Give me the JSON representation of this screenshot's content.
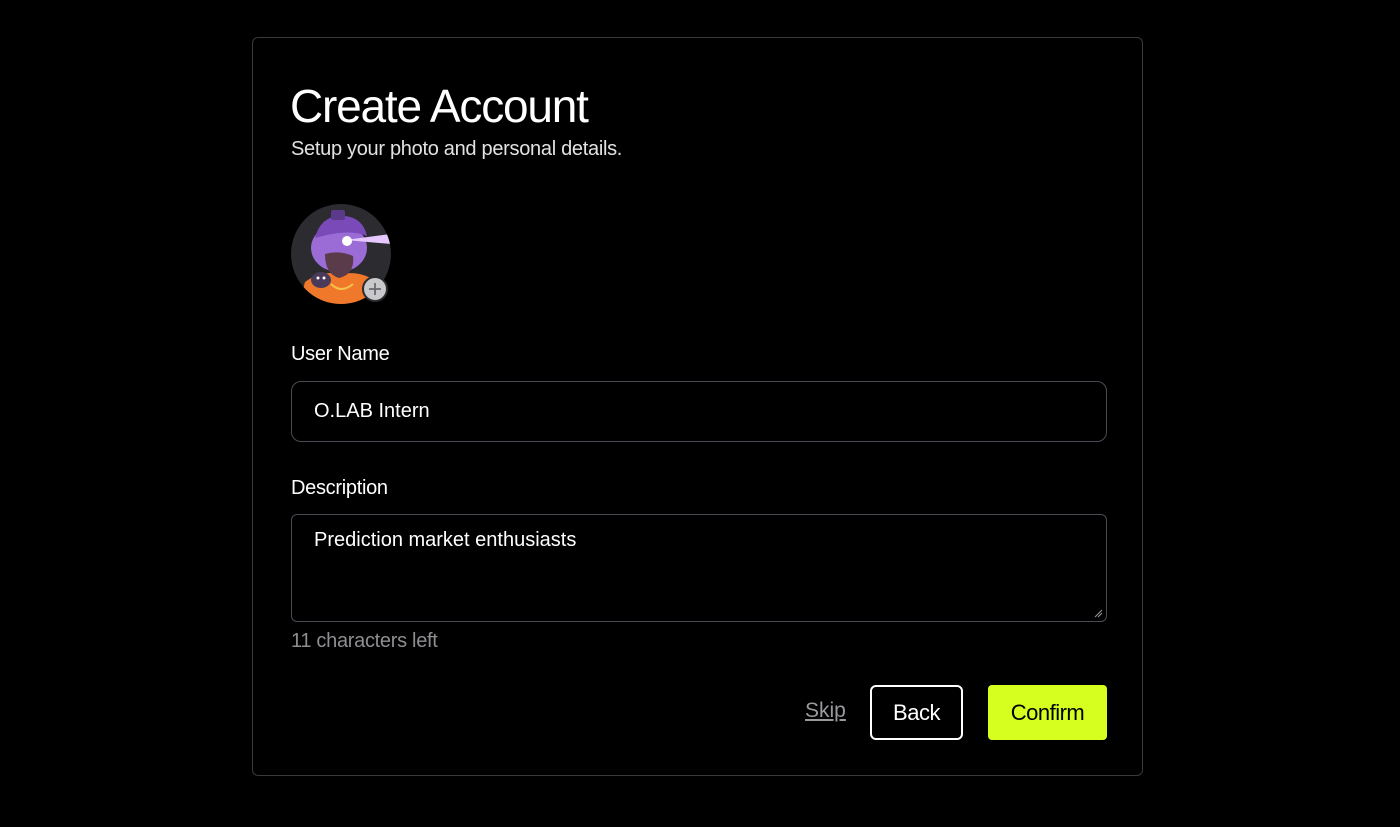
{
  "form": {
    "title": "Create Account",
    "subtitle": "Setup your photo and personal details.",
    "avatar": {
      "icon": "avatar-illustration",
      "add_icon": "plus-icon"
    },
    "username": {
      "label": "User Name",
      "value": "O.LAB Intern"
    },
    "description": {
      "label": "Description",
      "value": "Prediction market enthusiasts",
      "char_count": "11 characters left"
    },
    "actions": {
      "skip_label": "Skip",
      "back_label": "Back",
      "confirm_label": "Confirm"
    }
  },
  "colors": {
    "background": "#000000",
    "card_border": "#3a3a3e",
    "accent": "#d6ff1f",
    "muted_text": "#8e8e92"
  }
}
